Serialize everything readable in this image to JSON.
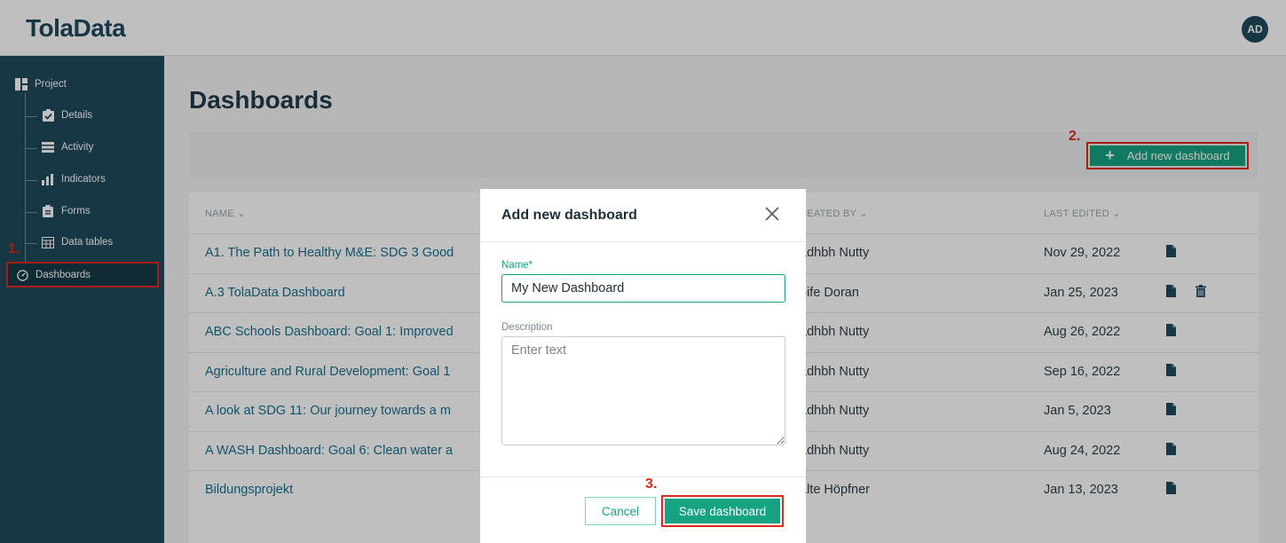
{
  "app": {
    "logo": "TolaData",
    "avatar_initials": "AD"
  },
  "sidebar": {
    "project_label": "Project",
    "items": [
      {
        "label": "Details",
        "icon": "clipboard-check-icon"
      },
      {
        "label": "Activity",
        "icon": "list-icon"
      },
      {
        "label": "Indicators",
        "icon": "bar-chart-icon"
      },
      {
        "label": "Forms",
        "icon": "clipboard-icon"
      },
      {
        "label": "Data tables",
        "icon": "table-icon"
      },
      {
        "label": "Dashboards",
        "icon": "gauge-icon",
        "active": true
      }
    ]
  },
  "annotations": {
    "step1": "1.",
    "step2": "2.",
    "step3": "3."
  },
  "main": {
    "title": "Dashboards",
    "add_button_label": "Add new dashboard",
    "table": {
      "columns": {
        "name": "NAME",
        "created_by": "REATED BY",
        "last_edited": "LAST EDITED"
      },
      "rows": [
        {
          "name": "A1. The Path to Healthy M&E: SDG 3 Good",
          "created_by": "adhbh Nutty",
          "last_edited": "Nov 29, 2022",
          "can_delete": false
        },
        {
          "name": "A.3 TolaData Dashboard",
          "created_by": "oife Doran",
          "last_edited": "Jan 25, 2023",
          "can_delete": true
        },
        {
          "name": "ABC Schools Dashboard: Goal 1: Improved",
          "created_by": "adhbh Nutty",
          "last_edited": "Aug 26, 2022",
          "can_delete": false
        },
        {
          "name": "Agriculture and Rural Development: Goal 1",
          "created_by": "adhbh Nutty",
          "last_edited": "Sep 16, 2022",
          "can_delete": false
        },
        {
          "name": "A look at SDG 11: Our journey towards a m",
          "created_by": "adhbh Nutty",
          "last_edited": "Jan 5, 2023",
          "can_delete": false
        },
        {
          "name": "A WASH Dashboard: Goal 6: Clean water a",
          "created_by": "adhbh Nutty",
          "last_edited": "Aug 24, 2022",
          "can_delete": false
        },
        {
          "name": "Bildungsprojekt",
          "created_by": "alte Höpfner",
          "last_edited": "Jan 13, 2023",
          "can_delete": false
        }
      ]
    }
  },
  "modal": {
    "title": "Add new dashboard",
    "name_label": "Name*",
    "name_value": "My New Dashboard",
    "description_label": "Description",
    "description_placeholder": "Enter text",
    "cancel_label": "Cancel",
    "save_label": "Save dashboard"
  },
  "colors": {
    "brand": "#1f4a5c",
    "accent": "#16a382",
    "annotation": "#e2281b",
    "link": "#1a6f8e"
  }
}
